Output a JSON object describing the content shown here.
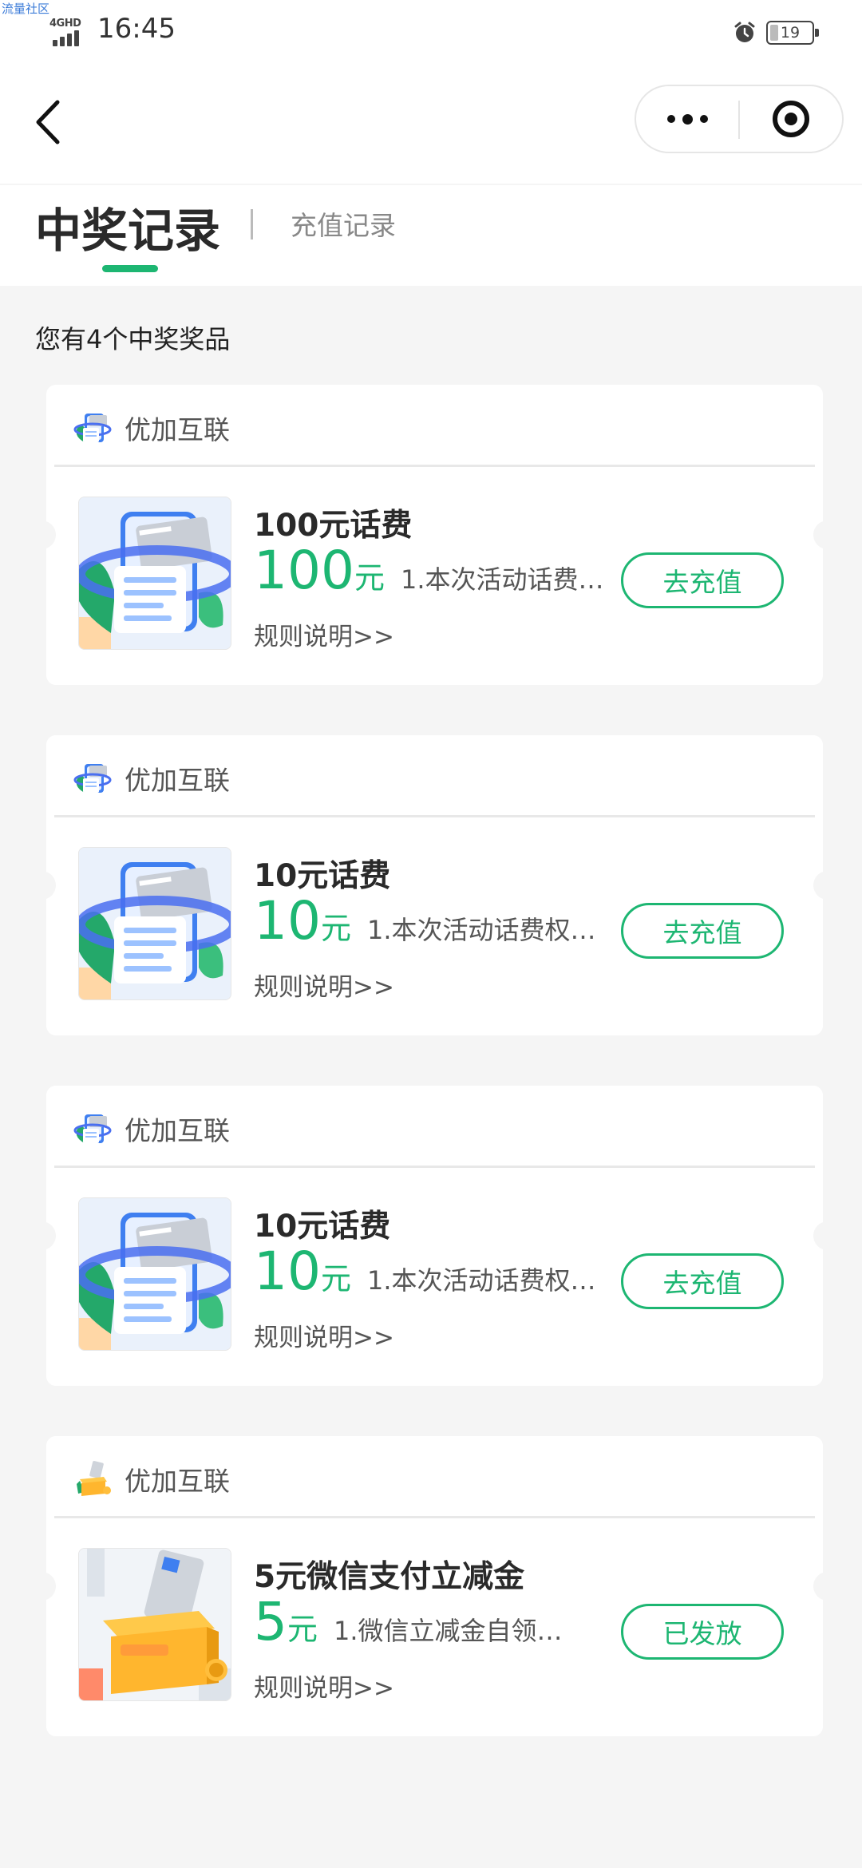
{
  "status_bar": {
    "watermark": "流量社区",
    "network": "4GHD",
    "time": "16:45",
    "battery": "19"
  },
  "nav": {
    "back_icon": "chevron-left-icon",
    "more_icon": "more-dots-icon",
    "close_icon": "target-circle-icon"
  },
  "tabs": {
    "active": "中奖记录",
    "inactive": "充值记录"
  },
  "colors": {
    "accent": "#1db672",
    "background": "#f5f5f5"
  },
  "summary": "您有4个中奖奖品",
  "prizes": [
    {
      "merchant": "优加互联",
      "title": "100元话费",
      "amount": "100",
      "unit": "元",
      "desc": "1.本次活动话费权…",
      "rules": "规则说明>>",
      "action": "去充值",
      "image": "phone-card-icon"
    },
    {
      "merchant": "优加互联",
      "title": "10元话费",
      "amount": "10",
      "unit": "元",
      "desc": "1.本次活动话费权…",
      "rules": "规则说明>>",
      "action": "去充值",
      "image": "phone-card-icon"
    },
    {
      "merchant": "优加互联",
      "title": "10元话费",
      "amount": "10",
      "unit": "元",
      "desc": "1.本次活动话费权…",
      "rules": "规则说明>>",
      "action": "去充值",
      "image": "phone-card-icon"
    },
    {
      "merchant": "优加互联",
      "title": "5元微信支付立减金",
      "amount": "5",
      "unit": "元",
      "desc": "1.微信立减金自领…",
      "rules": "规则说明>>",
      "action": "已发放",
      "image": "card-box-icon"
    }
  ]
}
